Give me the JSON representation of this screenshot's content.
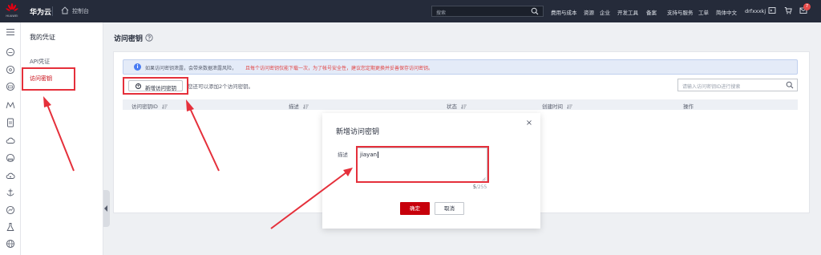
{
  "topbar": {
    "logo_text": "HUAWEI",
    "brand": "华为云",
    "console": "控制台",
    "search_placeholder": "搜索",
    "nav": [
      "费用与成本",
      "资源",
      "企业",
      "开发工具",
      "备案",
      "支持与服务",
      "工单",
      "简体中文",
      "drfxxxkj"
    ],
    "notification_count": "7"
  },
  "sidebar": {
    "title": "我的凭证",
    "items": [
      "API凭证",
      "访问密钥"
    ]
  },
  "main": {
    "page_title": "访问密钥",
    "notice_black": "如果访问密钥泄露，会带来数据泄露风险，",
    "notice_red": "且每个访问密钥仅能下载一次，为了帐号安全性，建议您定期更换并妥善保存访问密钥。",
    "add_button": "新增访问密钥",
    "quota_text": "您还可以添加2个访问密钥。",
    "search_placeholder": "请输入访问密钥ID进行搜索",
    "columns": [
      "访问密钥ID",
      "描述",
      "状态",
      "创建时间",
      "操作"
    ]
  },
  "modal": {
    "title": "新增访问密钥",
    "desc_label": "描述",
    "desc_value": "jiayan",
    "counter_current": "5",
    "counter_max": "/255",
    "ok": "确定",
    "cancel": "取消"
  },
  "colors": {
    "primary": "#c7000b",
    "topbar": "#252b3a",
    "annotation": "#e5303b",
    "info": "#4a7cf2"
  }
}
